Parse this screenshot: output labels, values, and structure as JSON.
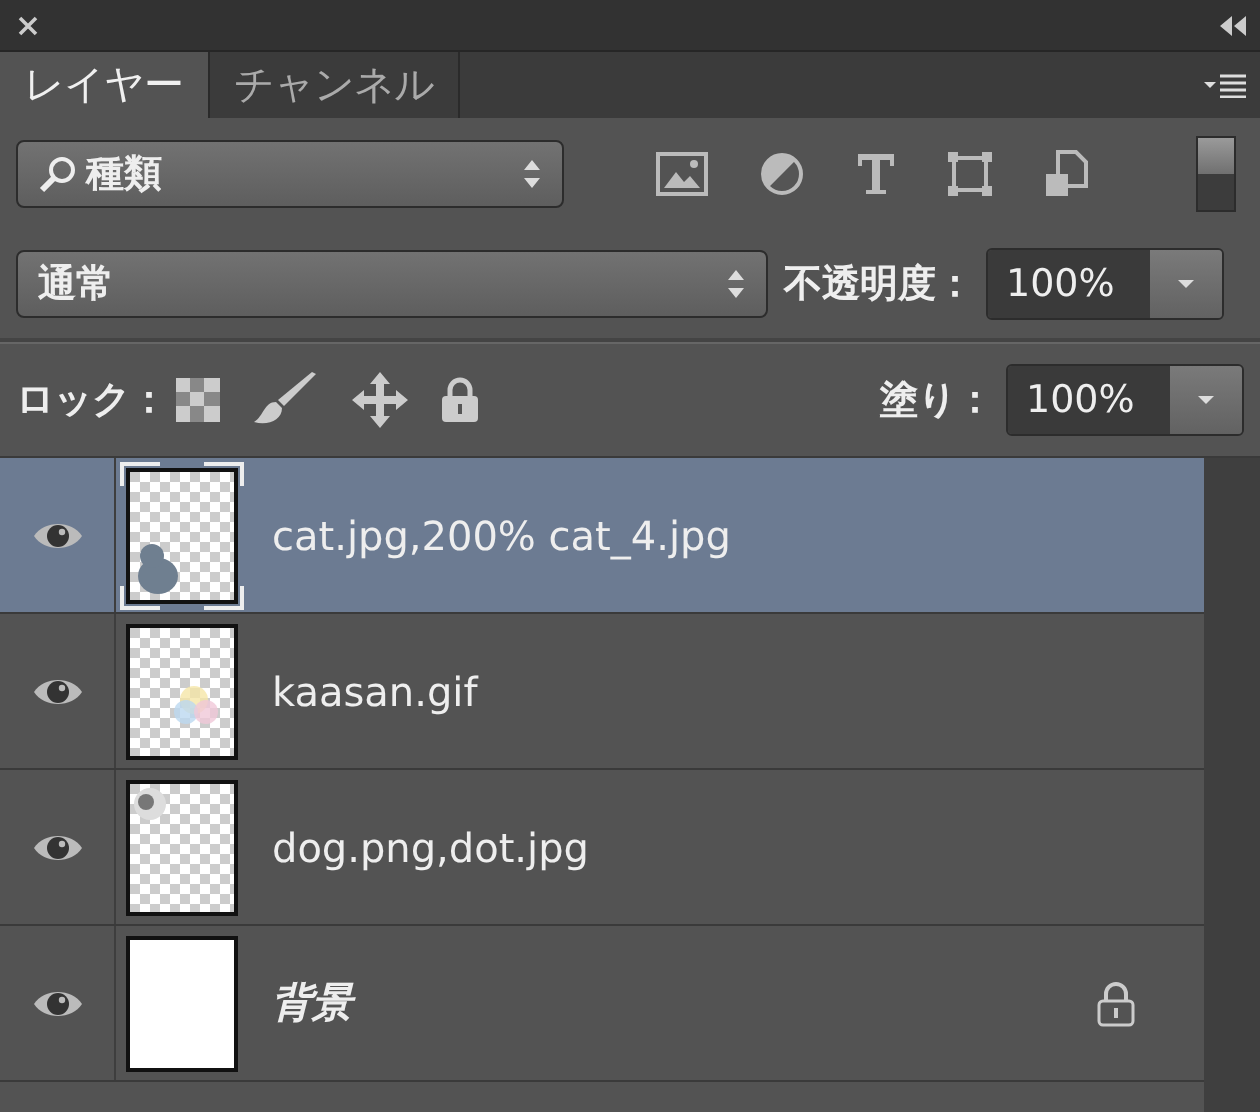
{
  "tabs": [
    {
      "label": "レイヤー",
      "selected": true
    },
    {
      "label": "チャンネル",
      "selected": false
    }
  ],
  "filter": {
    "value": "種類"
  },
  "blend_mode": {
    "value": "通常"
  },
  "opacity": {
    "label": "不透明度：",
    "value": "100%"
  },
  "lock": {
    "label": "ロック："
  },
  "fill": {
    "label": "塗り：",
    "value": "100%"
  },
  "layers": [
    {
      "name": "cat.jpg,200% cat_4.jpg",
      "kind": "layer",
      "visible": true,
      "selected": true,
      "locked": false
    },
    {
      "name": "kaasan.gif",
      "kind": "layer",
      "visible": true,
      "selected": false,
      "locked": false
    },
    {
      "name": "dog.png,dot.jpg",
      "kind": "layer",
      "visible": true,
      "selected": false,
      "locked": false
    },
    {
      "name": "背景",
      "kind": "background",
      "visible": true,
      "selected": false,
      "locked": true
    }
  ]
}
